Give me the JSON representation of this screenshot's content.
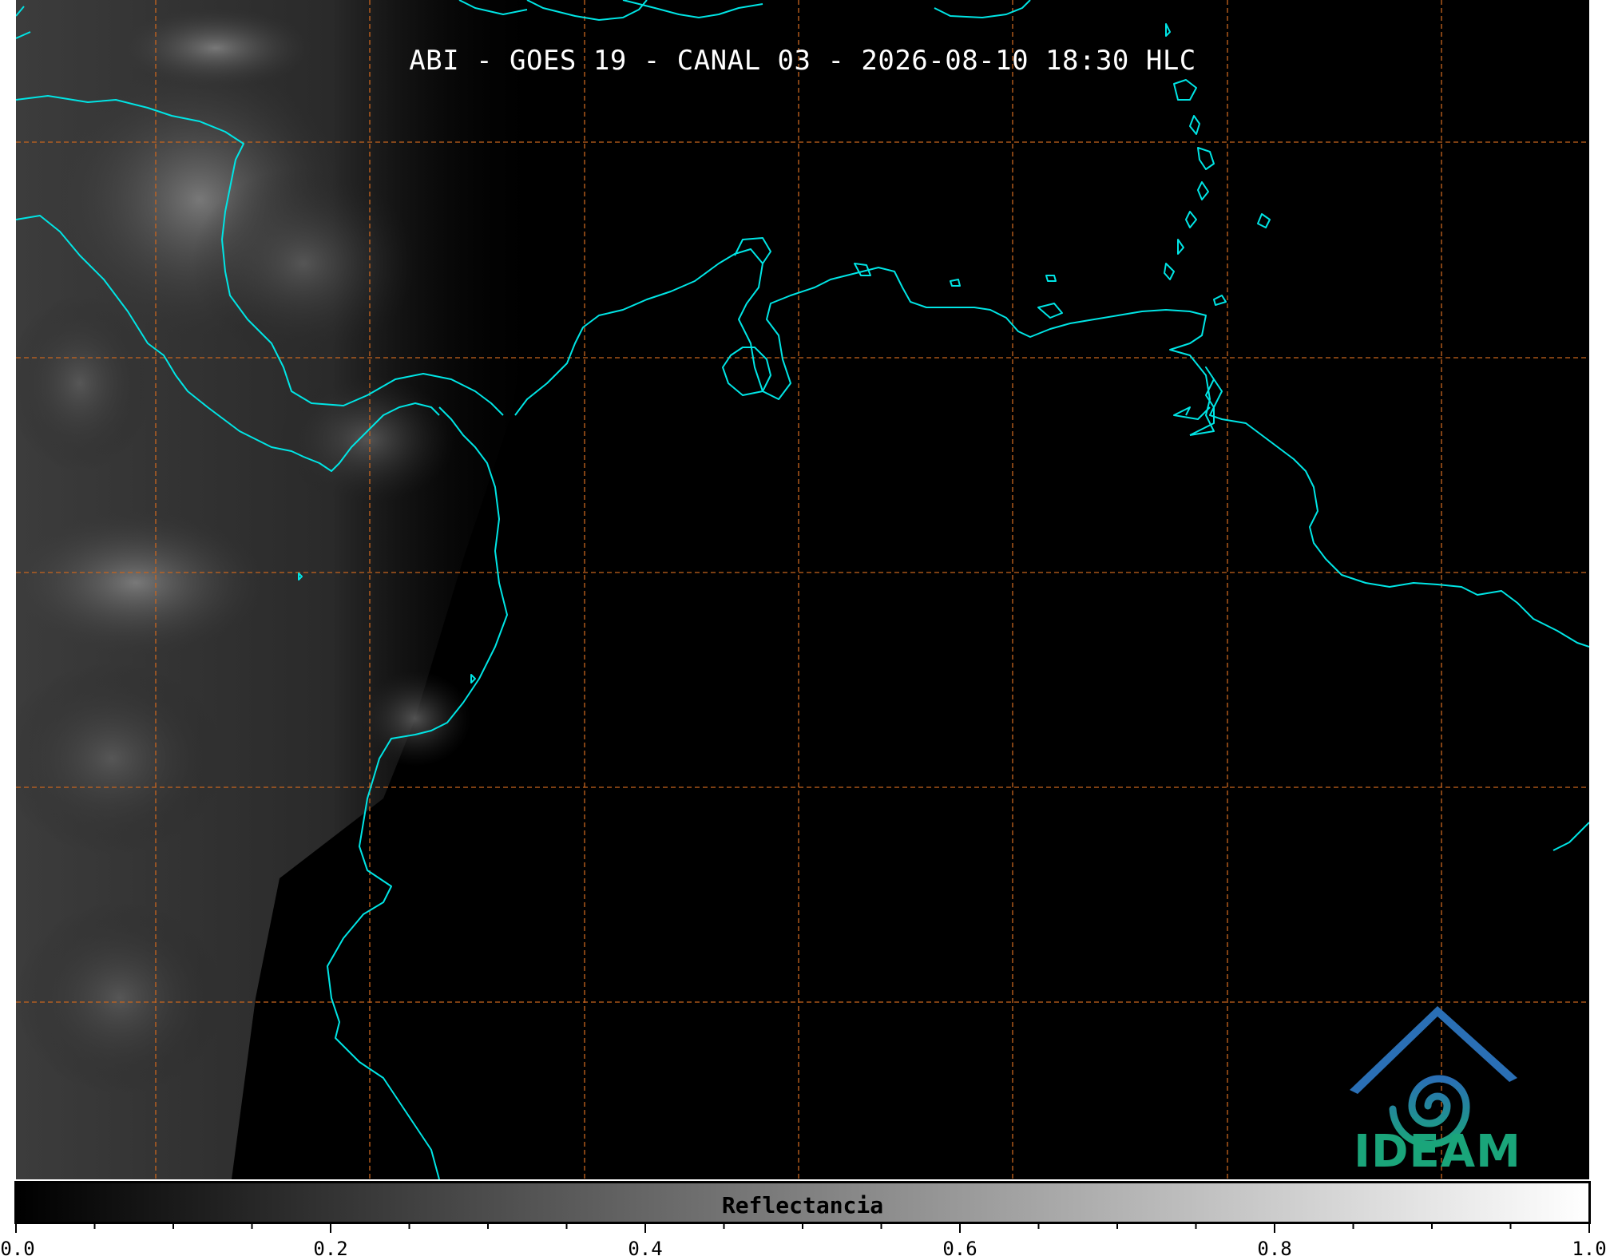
{
  "title": "ABI - GOES 19 - CANAL 03 - 2026-08-10 18:30 HLC",
  "colors": {
    "background": "#000000",
    "coastline": "#00e5e5",
    "grid": "#c8651e",
    "logo_teal": "#1aa57a",
    "logo_blue": "#2a6fb5"
  },
  "map": {
    "grid_style": "dashed",
    "grid_columns": 7,
    "grid_rows": 5
  },
  "logo": {
    "text": "IDEAM"
  },
  "colorbar": {
    "label": "Reflectancia",
    "range": [
      0.0,
      1.0
    ],
    "colormap": "grayscale black-to-white",
    "tick_labels": [
      "0.0",
      "0.2",
      "0.4",
      "0.6",
      "0.8",
      "1.0"
    ],
    "tick_values": [
      0.0,
      0.2,
      0.4,
      0.6,
      0.8,
      1.0
    ],
    "minor_tick_step": 0.05
  }
}
